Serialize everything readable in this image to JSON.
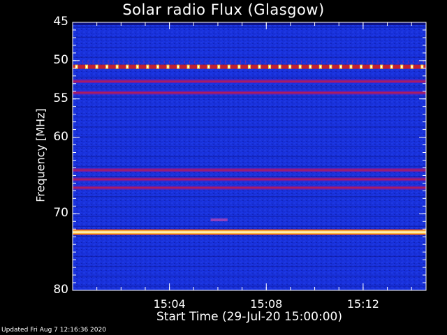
{
  "title": "Solar radio Flux (Glasgow)",
  "footer": "Updated Fri Aug  7 12:16:36 2020",
  "chart_data": {
    "type": "heatmap",
    "title": "Solar radio Flux (Glasgow)",
    "xlabel": "Start Time (29-Jul-20 15:00:00)",
    "ylabel": "Frequency [MHz]",
    "x_range_minutes": [
      0,
      14.6
    ],
    "xlim": [
      "15:00:00",
      "15:14:36"
    ],
    "ylim": [
      45,
      80
    ],
    "y_scale": "linear (inverted, 45 at top)",
    "x_ticks": [
      "15:04",
      "15:08",
      "15:12"
    ],
    "x_tick_minutes": [
      4,
      8,
      12
    ],
    "y_ticks": [
      45,
      50,
      55,
      60,
      70,
      80
    ],
    "colormap": [
      "#0a0a6e",
      "#1a2fe0",
      "#7a1aa0",
      "#d02020",
      "#ffd040",
      "#ffffff"
    ],
    "background_intensity": "low (blue)",
    "features": [
      {
        "type": "horizontal_band",
        "freq_mhz": 50.8,
        "intensity": "high",
        "pattern": "periodic bright bursts"
      },
      {
        "type": "horizontal_band",
        "freq_mhz": 52.7,
        "intensity": "medium"
      },
      {
        "type": "horizontal_band",
        "freq_mhz": 54.2,
        "intensity": "medium"
      },
      {
        "type": "horizontal_band",
        "freq_mhz": 64.3,
        "intensity": "medium"
      },
      {
        "type": "horizontal_band",
        "freq_mhz": 65.5,
        "intensity": "medium"
      },
      {
        "type": "horizontal_band",
        "freq_mhz": 66.6,
        "intensity": "medium"
      },
      {
        "type": "horizontal_band",
        "freq_mhz": 72.4,
        "intensity": "very high"
      },
      {
        "type": "spot",
        "freq_mhz": 70.8,
        "minute_range": [
          5.7,
          6.4
        ],
        "intensity": "low-medium"
      }
    ]
  }
}
